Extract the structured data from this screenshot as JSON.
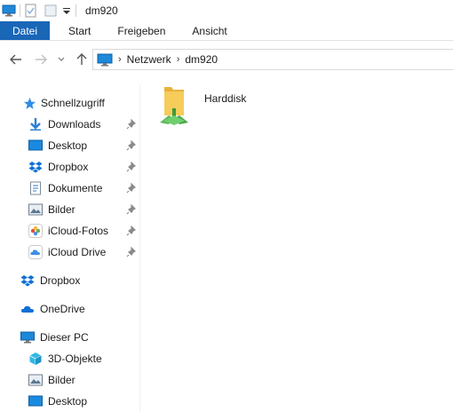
{
  "window": {
    "title": "dm920"
  },
  "ribbon": {
    "tabs": [
      "Datei",
      "Start",
      "Freigeben",
      "Ansicht"
    ]
  },
  "address": {
    "segments": [
      "Netzwerk",
      "dm920"
    ]
  },
  "nav": {
    "quick_access": "Schnellzugriff",
    "quick_items": [
      "Downloads",
      "Desktop",
      "Dropbox",
      "Dokumente",
      "Bilder",
      "iCloud-Fotos",
      "iCloud Drive"
    ],
    "dropbox": "Dropbox",
    "onedrive": "OneDrive",
    "this_pc": "Dieser PC",
    "pc_items": [
      "3D-Objekte",
      "Bilder",
      "Desktop"
    ]
  },
  "content": {
    "items": [
      {
        "name": "Harddisk",
        "icon": "network-drive-icon"
      }
    ]
  },
  "colors": {
    "accent": "#1a66b7",
    "folder": "#f4c64d",
    "network_green": "#3aa33a"
  }
}
